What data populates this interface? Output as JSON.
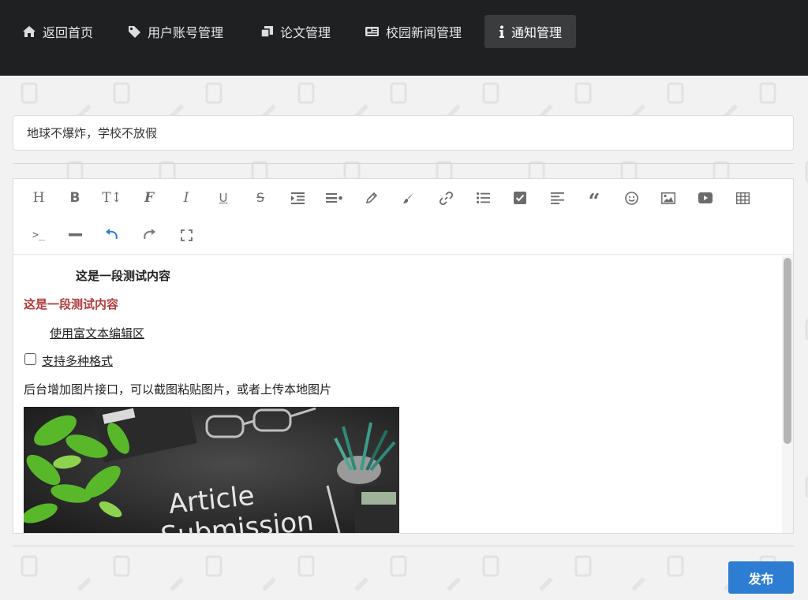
{
  "nav": {
    "items": [
      {
        "label": "返回首页",
        "icon": "home-icon"
      },
      {
        "label": "用户账号管理",
        "icon": "tag-icon"
      },
      {
        "label": "论文管理",
        "icon": "clone-icon"
      },
      {
        "label": "校园新闻管理",
        "icon": "newspaper-icon"
      },
      {
        "label": "通知管理",
        "icon": "info-icon",
        "active": true
      }
    ]
  },
  "form": {
    "title_value": "地球不爆炸，学校不放假",
    "publish_label": "发布"
  },
  "toolbar": {
    "buttons": [
      "heading",
      "bold",
      "size",
      "font",
      "italic",
      "underline",
      "strikethrough",
      "indent",
      "line-height",
      "color",
      "background",
      "link",
      "list",
      "todo",
      "align",
      "quote",
      "emoticon",
      "image",
      "video",
      "table",
      "code",
      "divider",
      "undo",
      "redo",
      "fullscreen"
    ]
  },
  "editor": {
    "line1": "这是一段测试内容",
    "line2": "这是一段测试内容",
    "line3": "使用富文本编辑区",
    "line4": "支持多种格式",
    "line5": "后台增加图片接口，可以截图粘贴图片，或者上传本地图片",
    "image_text": "Article Submission"
  },
  "colors": {
    "navbar": "#1f2021",
    "accent": "#2d7dd2",
    "red_text": "#b13b3b"
  }
}
